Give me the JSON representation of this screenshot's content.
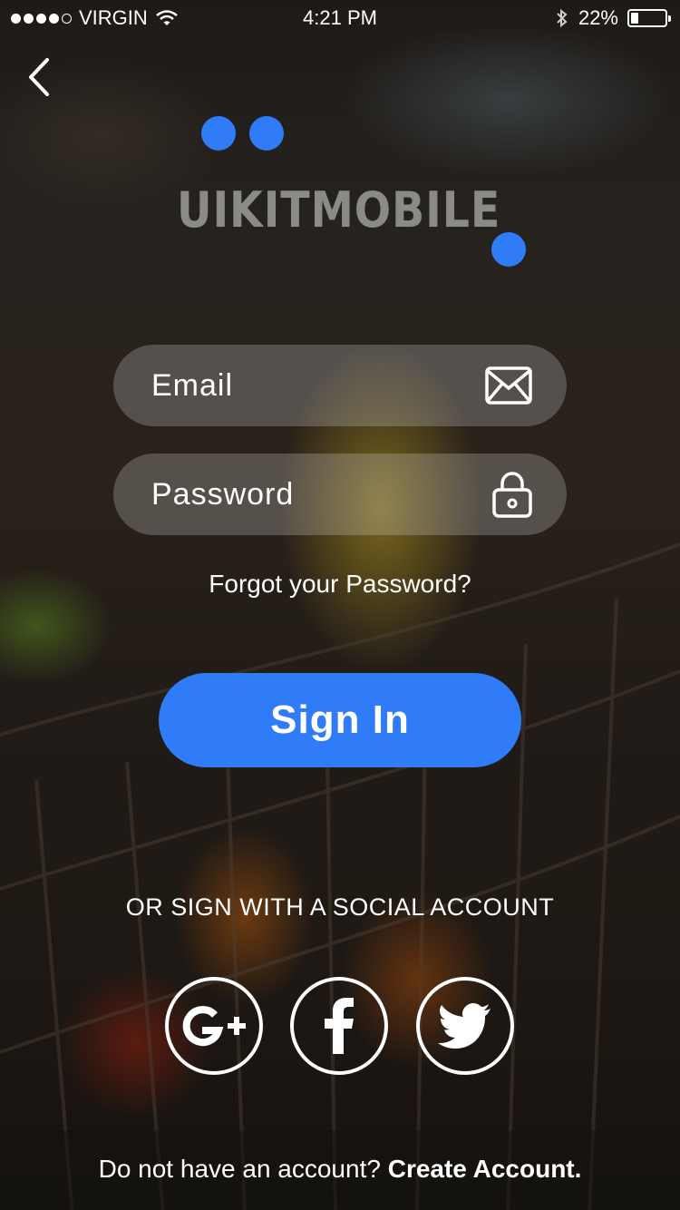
{
  "status_bar": {
    "carrier": "VIRGIN",
    "time": "4:21 PM",
    "battery": "22%",
    "battery_level": 0.22,
    "signal_bars": 4,
    "icons": [
      "signal-icon",
      "wifi-icon",
      "bluetooth-icon",
      "battery-icon"
    ]
  },
  "nav": {
    "back_icon": "chevron-left-icon"
  },
  "logo": {
    "text": "UIKITMOBILE",
    "accent_color": "#2f7bf8"
  },
  "form": {
    "email": {
      "placeholder": "Email",
      "value": "",
      "icon": "envelope-icon"
    },
    "password": {
      "placeholder": "Password",
      "value": "",
      "icon": "lock-icon"
    },
    "forgot_label": "Forgot your Password?",
    "signin_label": "Sign In"
  },
  "social": {
    "label": "OR SIGN WITH A SOCIAL ACCOUNT",
    "buttons": [
      {
        "name": "google-plus",
        "icon": "google-plus-icon"
      },
      {
        "name": "facebook",
        "icon": "facebook-icon"
      },
      {
        "name": "twitter",
        "icon": "twitter-icon"
      }
    ]
  },
  "footer": {
    "prompt": "Do not have an account?",
    "link": "Create Account."
  },
  "colors": {
    "primary": "#2f7bf8",
    "text": "#ffffff"
  }
}
